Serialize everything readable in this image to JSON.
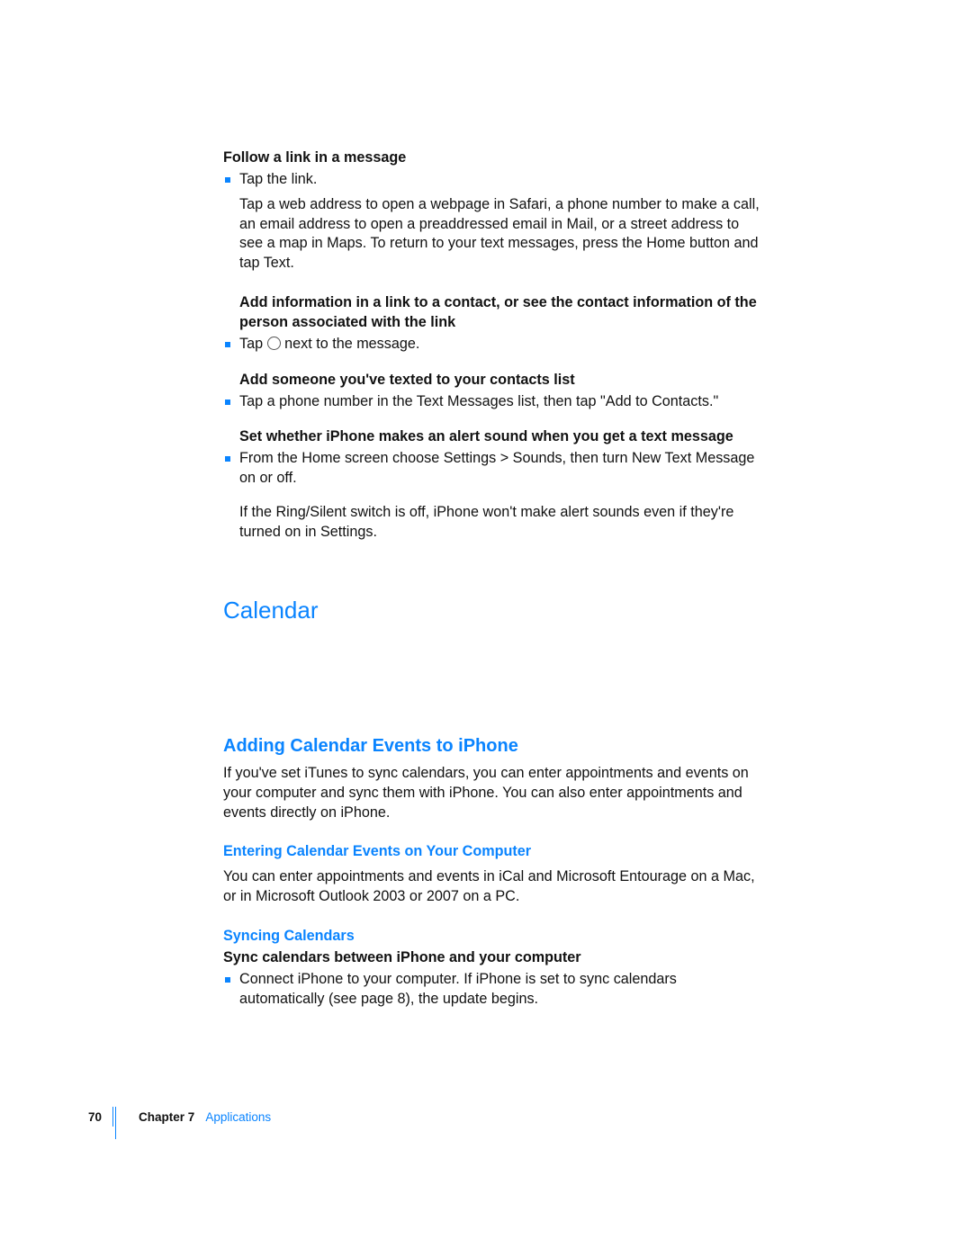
{
  "sections": {
    "follow_link_heading": "Follow a link in a message",
    "follow_link_bullet": "Tap the link.",
    "follow_link_para": "Tap a web address to open a webpage in Safari, a phone number to make a call, an email address to open a preaddressed email in Mail, or a street address to see a map in Maps. To return to your text messages, press the Home button and tap Text.",
    "add_info_heading": "Add information in a link to a contact, or see the contact information of the person associated with the link",
    "add_info_bullet_before": "Tap ",
    "add_info_bullet_after": " next to the message.",
    "add_someone_heading": "Add someone you've texted to your contacts list",
    "add_someone_bullet": "Tap a phone number in the Text Messages list, then tap \"Add to Contacts.\"",
    "alert_heading": "Set whether iPhone makes an alert sound when you get a text message",
    "alert_bullet": "From the Home screen choose Settings > Sounds, then turn New Text Message on or off.",
    "alert_para": "If the Ring/Silent switch is off, iPhone won't make alert sounds even if they're turned on in Settings.",
    "calendar_h1": "Calendar",
    "adding_h2": "Adding Calendar Events to iPhone",
    "adding_para": "If you've set iTunes to sync calendars, you can enter appointments and events on your computer and sync them with iPhone. You can also enter appointments and events directly on iPhone.",
    "entering_h3": "Entering Calendar Events on Your Computer",
    "entering_para": "You can enter appointments and events in iCal and Microsoft Entourage on a Mac, or in Microsoft Outlook 2003 or 2007 on a PC.",
    "syncing_h3": "Syncing Calendars",
    "syncing_bold": "Sync calendars between iPhone and your computer",
    "syncing_bullet": "Connect iPhone to your computer. If iPhone is set to sync calendars automatically (see page 8), the update begins."
  },
  "footer": {
    "page": "70",
    "chapter_label": "Chapter 7",
    "chapter_name": "Applications"
  }
}
